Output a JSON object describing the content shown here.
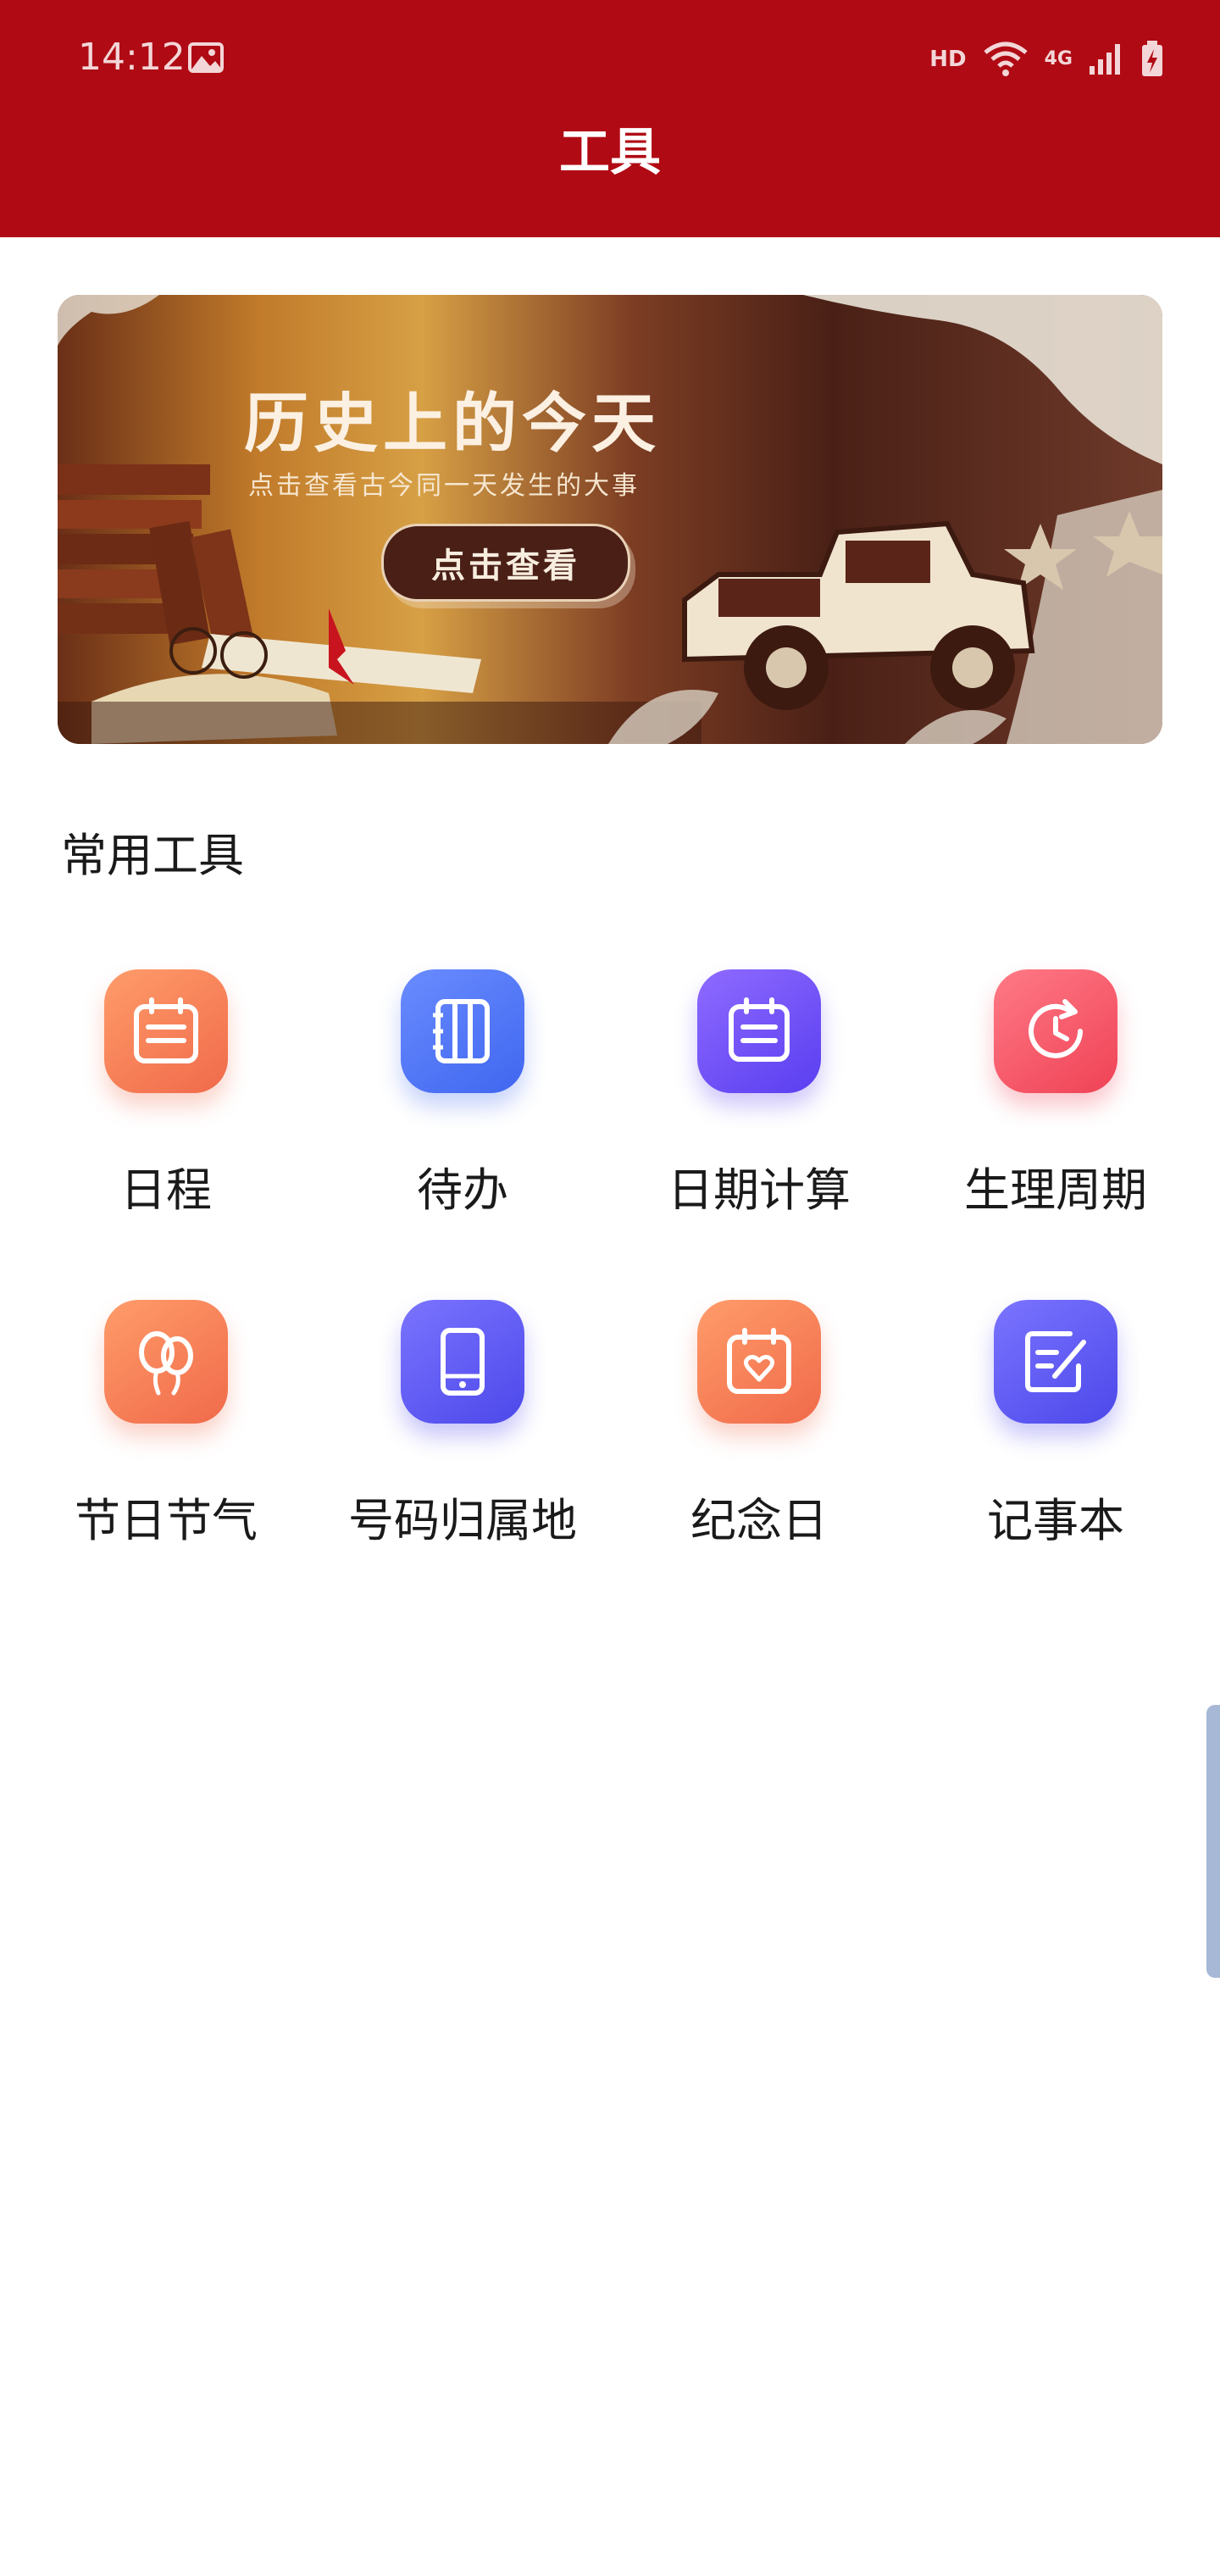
{
  "status_bar": {
    "time": "14:12",
    "hd": "HD",
    "network": "4G",
    "icons": [
      "image-icon",
      "wifi-icon",
      "signal-icon",
      "battery-charging-icon"
    ]
  },
  "header": {
    "title": "工具",
    "background_color": "#b00a14"
  },
  "banner": {
    "title": "历史上的今天",
    "subtitle": "点击查看古今同一天发生的大事",
    "button_label": "点击查看"
  },
  "section": {
    "title": "常用工具"
  },
  "tools": [
    {
      "label": "日程",
      "icon": "calendar-icon",
      "color": "#f47a55"
    },
    {
      "label": "待办",
      "icon": "notebook-icon",
      "color": "#4f74f5"
    },
    {
      "label": "日期计算",
      "icon": "calendar-list-icon",
      "color": "#6a4cf2"
    },
    {
      "label": "生理周期",
      "icon": "clock-cycle-icon",
      "color": "#f3566a"
    },
    {
      "label": "节日节气",
      "icon": "balloon-icon",
      "color": "#f47a55"
    },
    {
      "label": "号码归属地",
      "icon": "phone-icon",
      "color": "#5752ee"
    },
    {
      "label": "纪念日",
      "icon": "calendar-heart-icon",
      "color": "#f47a55"
    },
    {
      "label": "记事本",
      "icon": "note-edit-icon",
      "color": "#5752ee"
    }
  ]
}
